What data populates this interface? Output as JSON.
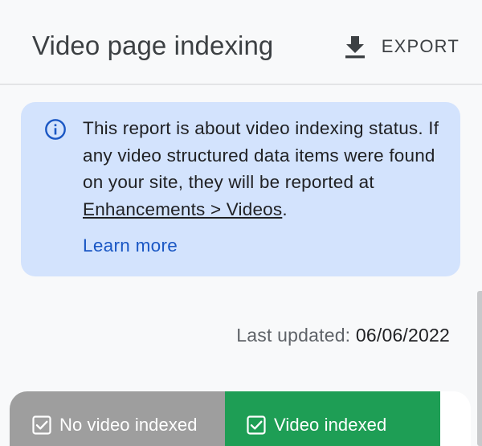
{
  "header": {
    "title": "Video page indexing",
    "export_icon": "download-icon",
    "export_label": "EXPORT"
  },
  "info_banner": {
    "icon": "info-icon",
    "text_before_link": "This report is about video indexing status. If any video structured data items were found on your site, they will be reported at ",
    "link_text": "Enhancements > Videos",
    "text_after_link": ".",
    "learn_more": "Learn more"
  },
  "last_updated": {
    "label": "Last updated: ",
    "value": "06/06/2022"
  },
  "summary_tabs": [
    {
      "label": "No video indexed",
      "checked": true,
      "color": "#9e9e9e",
      "icon": "checkbox-checked-icon"
    },
    {
      "label": "Video indexed",
      "checked": true,
      "color": "#1e9e55",
      "icon": "checkbox-checked-icon"
    }
  ],
  "colors": {
    "banner_bg": "#d3e3fd",
    "link_blue": "#1a57c4",
    "background": "#f8f9fa"
  }
}
